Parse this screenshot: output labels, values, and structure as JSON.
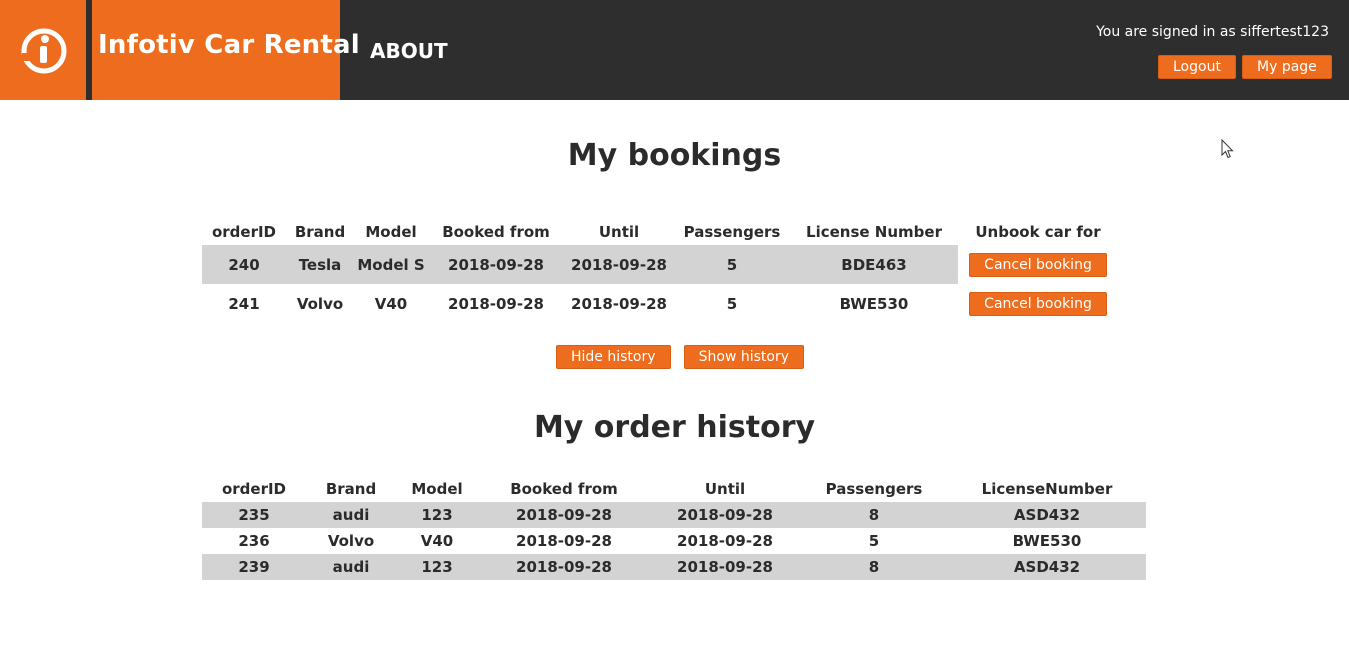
{
  "header": {
    "brand_title": "Infotiv Car Rental",
    "about_label": "ABOUT",
    "signed_in_text": "You are signed in as siffertest123",
    "logout_label": "Logout",
    "mypage_label": "My page"
  },
  "bookings": {
    "title": "My bookings",
    "columns": [
      "orderID",
      "Brand",
      "Model",
      "Booked from",
      "Until",
      "Passengers",
      "License Number",
      "Unbook car for"
    ],
    "rows": [
      {
        "orderID": "240",
        "brand": "Tesla",
        "model": "Model S",
        "booked_from": "2018-09-28",
        "until": "2018-09-28",
        "passengers": "5",
        "license": "BDE463",
        "action_label": "Cancel booking"
      },
      {
        "orderID": "241",
        "brand": "Volvo",
        "model": "V40",
        "booked_from": "2018-09-28",
        "until": "2018-09-28",
        "passengers": "5",
        "license": "BWE530",
        "action_label": "Cancel booking"
      }
    ]
  },
  "history_controls": {
    "hide_label": "Hide history",
    "show_label": "Show history"
  },
  "history": {
    "title": "My order history",
    "columns": [
      "orderID",
      "Brand",
      "Model",
      "Booked from",
      "Until",
      "Passengers",
      "LicenseNumber"
    ],
    "rows": [
      {
        "orderID": "235",
        "brand": "audi",
        "model": "123",
        "booked_from": "2018-09-28",
        "until": "2018-09-28",
        "passengers": "8",
        "license": "ASD432"
      },
      {
        "orderID": "236",
        "brand": "Volvo",
        "model": "V40",
        "booked_from": "2018-09-28",
        "until": "2018-09-28",
        "passengers": "5",
        "license": "BWE530"
      },
      {
        "orderID": "239",
        "brand": "audi",
        "model": "123",
        "booked_from": "2018-09-28",
        "until": "2018-09-28",
        "passengers": "8",
        "license": "ASD432"
      }
    ]
  },
  "colors": {
    "accent": "#ee6c1d",
    "header_bg": "#2e2e2e",
    "row_shade": "#d3d3d3"
  },
  "icons": {
    "logo": "infotiv-logo-icon",
    "cursor": "mouse-cursor-icon"
  }
}
